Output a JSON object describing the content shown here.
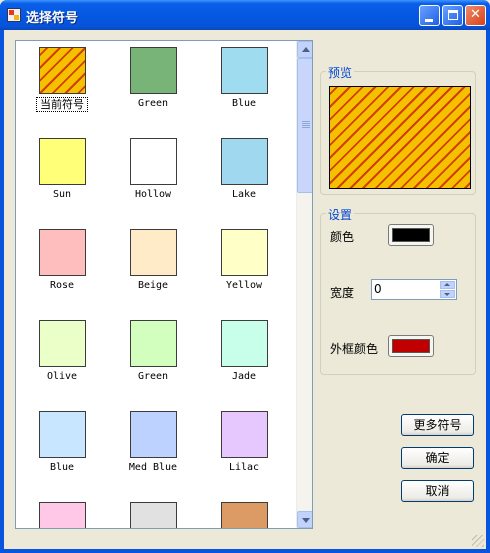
{
  "window": {
    "title": "选择符号"
  },
  "symbols": [
    {
      "label": "当前符号",
      "color": "#f5a000",
      "pattern": "hatch"
    },
    {
      "label": "Green",
      "color": "#78b478"
    },
    {
      "label": "Blue",
      "color": "#a0dcf0"
    },
    {
      "label": "Sun",
      "color": "#ffff78"
    },
    {
      "label": "Hollow",
      "color": "#ffffff"
    },
    {
      "label": "Lake",
      "color": "#a0d8f0"
    },
    {
      "label": "Rose",
      "color": "#ffbebe"
    },
    {
      "label": "Beige",
      "color": "#ffebc8"
    },
    {
      "label": "Yellow",
      "color": "#ffffc8"
    },
    {
      "label": "Olive",
      "color": "#ebffc8"
    },
    {
      "label": "Green",
      "color": "#d2ffbe"
    },
    {
      "label": "Jade",
      "color": "#c8ffeb"
    },
    {
      "label": "Blue",
      "color": "#c8e6ff"
    },
    {
      "label": "Med Blue",
      "color": "#bed2ff"
    },
    {
      "label": "Lilac",
      "color": "#e6c8ff"
    },
    {
      "label": "",
      "color": "#ffc8e6"
    },
    {
      "label": "",
      "color": "#e1e1e1"
    },
    {
      "label": "",
      "color": "#dc9a64"
    }
  ],
  "preview": {
    "legend": "预览",
    "pattern": "hatch"
  },
  "settings": {
    "legend": "设置",
    "color_label": "颜色",
    "color_value": "#000000",
    "width_label": "宽度",
    "width_value": "0",
    "outline_label": "外框颜色",
    "outline_value": "#c00000"
  },
  "buttons": {
    "more_symbols": "更多符号",
    "ok": "确定",
    "cancel": "取消"
  }
}
